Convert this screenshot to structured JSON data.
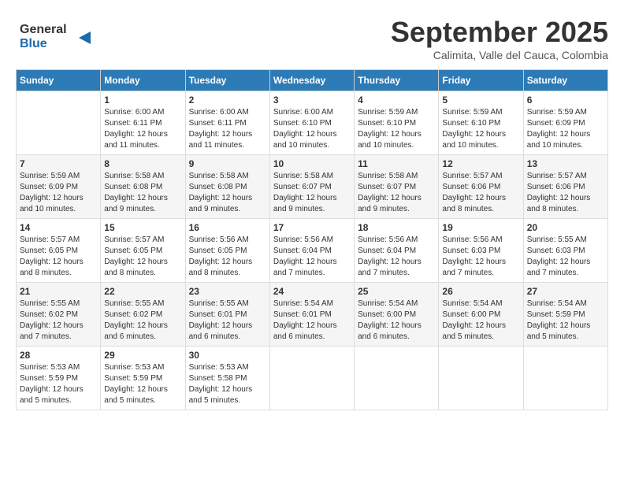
{
  "header": {
    "logo": {
      "line1": "General",
      "line2": "Blue"
    },
    "title": "September 2025",
    "subtitle": "Calimita, Valle del Cauca, Colombia"
  },
  "days_of_week": [
    "Sunday",
    "Monday",
    "Tuesday",
    "Wednesday",
    "Thursday",
    "Friday",
    "Saturday"
  ],
  "weeks": [
    [
      {
        "day": "",
        "info": ""
      },
      {
        "day": "1",
        "info": "Sunrise: 6:00 AM\nSunset: 6:11 PM\nDaylight: 12 hours\nand 11 minutes."
      },
      {
        "day": "2",
        "info": "Sunrise: 6:00 AM\nSunset: 6:11 PM\nDaylight: 12 hours\nand 11 minutes."
      },
      {
        "day": "3",
        "info": "Sunrise: 6:00 AM\nSunset: 6:10 PM\nDaylight: 12 hours\nand 10 minutes."
      },
      {
        "day": "4",
        "info": "Sunrise: 5:59 AM\nSunset: 6:10 PM\nDaylight: 12 hours\nand 10 minutes."
      },
      {
        "day": "5",
        "info": "Sunrise: 5:59 AM\nSunset: 6:10 PM\nDaylight: 12 hours\nand 10 minutes."
      },
      {
        "day": "6",
        "info": "Sunrise: 5:59 AM\nSunset: 6:09 PM\nDaylight: 12 hours\nand 10 minutes."
      }
    ],
    [
      {
        "day": "7",
        "info": "Sunrise: 5:59 AM\nSunset: 6:09 PM\nDaylight: 12 hours\nand 10 minutes."
      },
      {
        "day": "8",
        "info": "Sunrise: 5:58 AM\nSunset: 6:08 PM\nDaylight: 12 hours\nand 9 minutes."
      },
      {
        "day": "9",
        "info": "Sunrise: 5:58 AM\nSunset: 6:08 PM\nDaylight: 12 hours\nand 9 minutes."
      },
      {
        "day": "10",
        "info": "Sunrise: 5:58 AM\nSunset: 6:07 PM\nDaylight: 12 hours\nand 9 minutes."
      },
      {
        "day": "11",
        "info": "Sunrise: 5:58 AM\nSunset: 6:07 PM\nDaylight: 12 hours\nand 9 minutes."
      },
      {
        "day": "12",
        "info": "Sunrise: 5:57 AM\nSunset: 6:06 PM\nDaylight: 12 hours\nand 8 minutes."
      },
      {
        "day": "13",
        "info": "Sunrise: 5:57 AM\nSunset: 6:06 PM\nDaylight: 12 hours\nand 8 minutes."
      }
    ],
    [
      {
        "day": "14",
        "info": "Sunrise: 5:57 AM\nSunset: 6:05 PM\nDaylight: 12 hours\nand 8 minutes."
      },
      {
        "day": "15",
        "info": "Sunrise: 5:57 AM\nSunset: 6:05 PM\nDaylight: 12 hours\nand 8 minutes."
      },
      {
        "day": "16",
        "info": "Sunrise: 5:56 AM\nSunset: 6:05 PM\nDaylight: 12 hours\nand 8 minutes."
      },
      {
        "day": "17",
        "info": "Sunrise: 5:56 AM\nSunset: 6:04 PM\nDaylight: 12 hours\nand 7 minutes."
      },
      {
        "day": "18",
        "info": "Sunrise: 5:56 AM\nSunset: 6:04 PM\nDaylight: 12 hours\nand 7 minutes."
      },
      {
        "day": "19",
        "info": "Sunrise: 5:56 AM\nSunset: 6:03 PM\nDaylight: 12 hours\nand 7 minutes."
      },
      {
        "day": "20",
        "info": "Sunrise: 5:55 AM\nSunset: 6:03 PM\nDaylight: 12 hours\nand 7 minutes."
      }
    ],
    [
      {
        "day": "21",
        "info": "Sunrise: 5:55 AM\nSunset: 6:02 PM\nDaylight: 12 hours\nand 7 minutes."
      },
      {
        "day": "22",
        "info": "Sunrise: 5:55 AM\nSunset: 6:02 PM\nDaylight: 12 hours\nand 6 minutes."
      },
      {
        "day": "23",
        "info": "Sunrise: 5:55 AM\nSunset: 6:01 PM\nDaylight: 12 hours\nand 6 minutes."
      },
      {
        "day": "24",
        "info": "Sunrise: 5:54 AM\nSunset: 6:01 PM\nDaylight: 12 hours\nand 6 minutes."
      },
      {
        "day": "25",
        "info": "Sunrise: 5:54 AM\nSunset: 6:00 PM\nDaylight: 12 hours\nand 6 minutes."
      },
      {
        "day": "26",
        "info": "Sunrise: 5:54 AM\nSunset: 6:00 PM\nDaylight: 12 hours\nand 5 minutes."
      },
      {
        "day": "27",
        "info": "Sunrise: 5:54 AM\nSunset: 5:59 PM\nDaylight: 12 hours\nand 5 minutes."
      }
    ],
    [
      {
        "day": "28",
        "info": "Sunrise: 5:53 AM\nSunset: 5:59 PM\nDaylight: 12 hours\nand 5 minutes."
      },
      {
        "day": "29",
        "info": "Sunrise: 5:53 AM\nSunset: 5:59 PM\nDaylight: 12 hours\nand 5 minutes."
      },
      {
        "day": "30",
        "info": "Sunrise: 5:53 AM\nSunset: 5:58 PM\nDaylight: 12 hours\nand 5 minutes."
      },
      {
        "day": "",
        "info": ""
      },
      {
        "day": "",
        "info": ""
      },
      {
        "day": "",
        "info": ""
      },
      {
        "day": "",
        "info": ""
      }
    ]
  ]
}
